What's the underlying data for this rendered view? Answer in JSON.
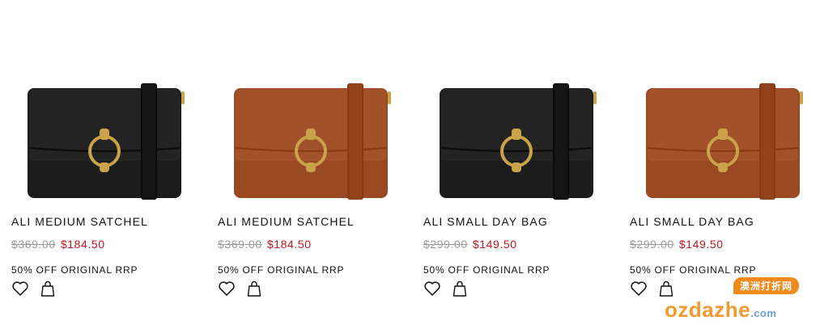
{
  "products": [
    {
      "name": "ALI MEDIUM SATCHEL",
      "original_price": "$369.00",
      "sale_price": "$184.50",
      "promo": "50% OFF ORIGINAL RRP",
      "color": "black",
      "leather_hex": "#1c1c1c"
    },
    {
      "name": "ALI MEDIUM SATCHEL",
      "original_price": "$369.00",
      "sale_price": "$184.50",
      "promo": "50% OFF ORIGINAL RRP",
      "color": "tan",
      "leather_hex": "#9a4a22"
    },
    {
      "name": "ALI SMALL DAY BAG",
      "original_price": "$299.00",
      "sale_price": "$149.50",
      "promo": "50% OFF ORIGINAL RRP",
      "color": "black",
      "leather_hex": "#1c1c1c"
    },
    {
      "name": "ALI SMALL DAY BAG",
      "original_price": "$299.00",
      "sale_price": "$149.50",
      "promo": "50% OFF ORIGINAL RRP",
      "color": "tan",
      "leather_hex": "#9a4a22"
    }
  ],
  "icons": {
    "wishlist": "heart-icon",
    "add_to_bag": "shopping-bag-icon"
  },
  "colors": {
    "sale_price": "#c4161c",
    "strikethrough": "#9a9a9a",
    "hardware": "#c9a24a"
  },
  "watermark": {
    "tag": "澳洲打折网",
    "logo_main": "ozdazhe",
    "logo_suffix": ".com"
  }
}
